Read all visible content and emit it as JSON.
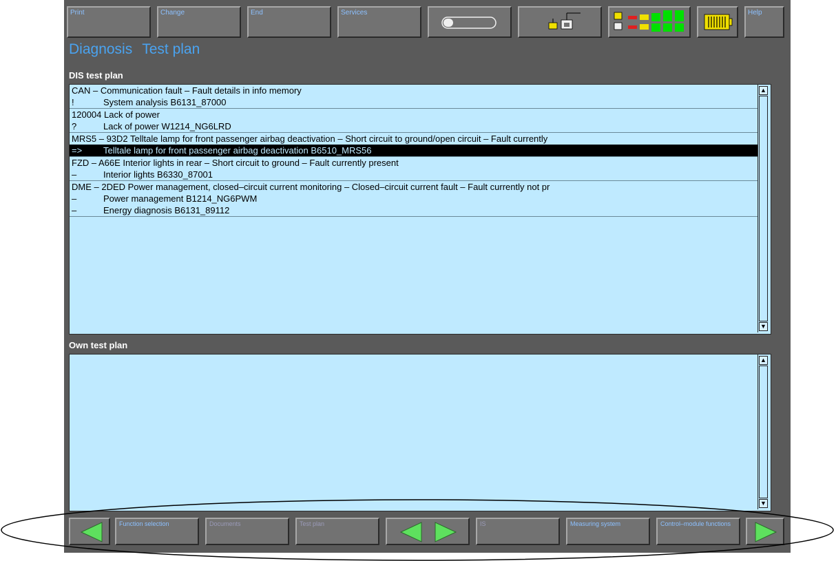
{
  "toolbar": {
    "print_label": "Print",
    "change_label": "Change",
    "end_label": "End",
    "services_label": "Services",
    "help_label": "Help"
  },
  "header": {
    "section": "Diagnosis",
    "page": "Test plan"
  },
  "dis_test_plan": {
    "label": "DIS test plan",
    "groups": [
      {
        "lines": [
          {
            "marker": "",
            "text": "CAN – Communication fault – Fault details in info memory"
          },
          {
            "marker": "!",
            "text": "System analysis  B6131_87000"
          }
        ]
      },
      {
        "lines": [
          {
            "marker": "",
            "text": "120004 Lack of power"
          },
          {
            "marker": "?",
            "text": "Lack of power  W1214_NG6LRD"
          }
        ]
      },
      {
        "lines": [
          {
            "marker": "",
            "text": "MRS5 – 93D2 Telltale lamp for front passenger airbag deactivation – Short circuit to ground/open circuit – Fault currently"
          },
          {
            "marker": "=>",
            "text": "Telltale lamp for front passenger airbag deactivation  B6510_MRS56",
            "selected": true
          }
        ]
      },
      {
        "lines": [
          {
            "marker": "",
            "text": "FZD – A66E Interior lights in rear – Short circuit to ground – Fault currently present"
          },
          {
            "marker": "–",
            "text": "Interior lights  B6330_87001"
          }
        ]
      },
      {
        "lines": [
          {
            "marker": "",
            "text": "DME – 2DED Power management, closed–circuit current monitoring – Closed–circuit current fault – Fault currently not pr"
          },
          {
            "marker": "–",
            "text": "Power management  B1214_NG6PWM"
          },
          {
            "marker": "–",
            "text": "Energy diagnosis  B6131_89112"
          }
        ]
      }
    ]
  },
  "own_test_plan": {
    "label": "Own test plan"
  },
  "bottom_nav": {
    "function_selection": "Function selection",
    "documents": "Documents",
    "test_plan": "Test plan",
    "is": "IS",
    "measuring_system": "Measuring system",
    "control_module_functions": "Control–module functions"
  },
  "colors": {
    "accent_blue": "#4aa3f0",
    "panel_bg": "#bfeaff",
    "arrow_green": "#5ee05e",
    "status_yellow": "#f0e000",
    "status_red": "#e02020"
  }
}
